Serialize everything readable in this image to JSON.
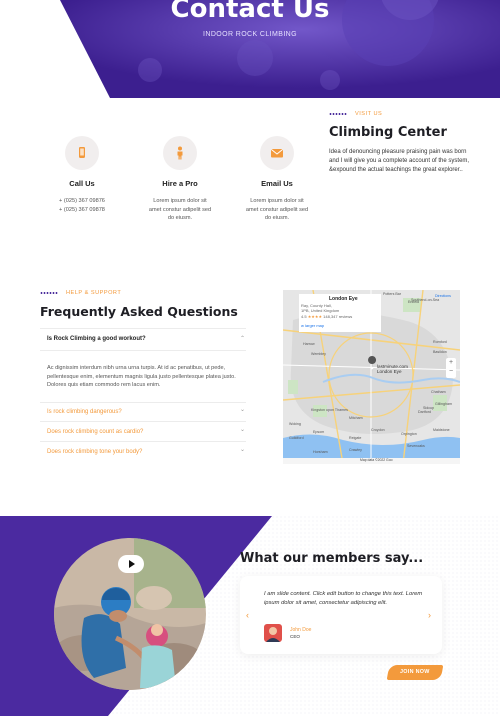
{
  "hero": {
    "title": "Contact Us",
    "subtitle": "INDOOR ROCK CLIMBING"
  },
  "contact_cards": [
    {
      "icon": "phone-icon",
      "title": "Call Us",
      "lines": [
        "+ (025) 367 09876",
        "+ (025) 367 09878"
      ]
    },
    {
      "icon": "person-icon",
      "title": "Hire a Pro",
      "lines": [
        "Lorem ipsum dolor sit",
        "amet constur adipelit sed",
        "do eiusm."
      ]
    },
    {
      "icon": "envelope-icon",
      "title": "Email Us",
      "lines": [
        "Lorem ipsum dolor sit",
        "amet constur adipelit sed",
        "do eiusm."
      ]
    }
  ],
  "visit": {
    "eyebrow": "VISIT US",
    "title": "Climbing Center",
    "text": "Idea of denouncing pleasure praising pain was born and I will give you a complete account of the system, &expound the actual teachings the great explorer.."
  },
  "faq": {
    "eyebrow": "HELP & SUPPORT",
    "title": "Frequently Asked Questions",
    "items": [
      {
        "question": "Is Rock Climbing a good workout?",
        "answer": "Ac dignissim interdum nibh urna urna turpis. At id ac penatibus, ut pede, pellentesque enim, elementum magnis ligula justo pellentesque platea justo. Dolores quis etiam commodo rem lacus enim.",
        "open": true
      },
      {
        "question": "Is rock climbing dangerous?",
        "open": false
      },
      {
        "question": "Does rock climbing count as cardio?",
        "open": false
      },
      {
        "question": "Does rock climbing tone your body?",
        "open": false
      }
    ]
  },
  "map": {
    "place_name": "London Eye",
    "address_1": "Ray, County Hall,",
    "address_2": "1PB, United Kingdom",
    "rating": "4.5",
    "reviews": "148,347 reviews",
    "larger_map": "w larger map",
    "pin_label_1": "lastminute.com",
    "pin_label_2": "London Eye",
    "directions": "Directions",
    "footer": "Map data ©2022 Goo",
    "place_labels": [
      "Potters Bar",
      "Enfield",
      "Harrow",
      "Wembley",
      "Romford",
      "Basildon",
      "Southend-on-Sea",
      "Chatham",
      "Kingston upon Thames",
      "Croydon",
      "Mitcham",
      "Epsom",
      "Dartford",
      "Orpington",
      "Sidcup",
      "Maidstone",
      "Gillingham",
      "Sevenoaks",
      "Crawley",
      "Horsham",
      "Reigate",
      "Guildford",
      "Woking"
    ]
  },
  "testimonials": {
    "title": "What our members say...",
    "quote": "I am slide content. Click edit button to change this text. Lorem ipsum dolor sit amet, consectetur adipiscing elit.",
    "author": "John Doe",
    "role": "CEO",
    "button": "JOIN NOW",
    "prev": "‹",
    "next": "›"
  },
  "colors": {
    "primary": "#4b2aa0",
    "accent": "#f39a3c",
    "dark": "#1e1e24"
  }
}
